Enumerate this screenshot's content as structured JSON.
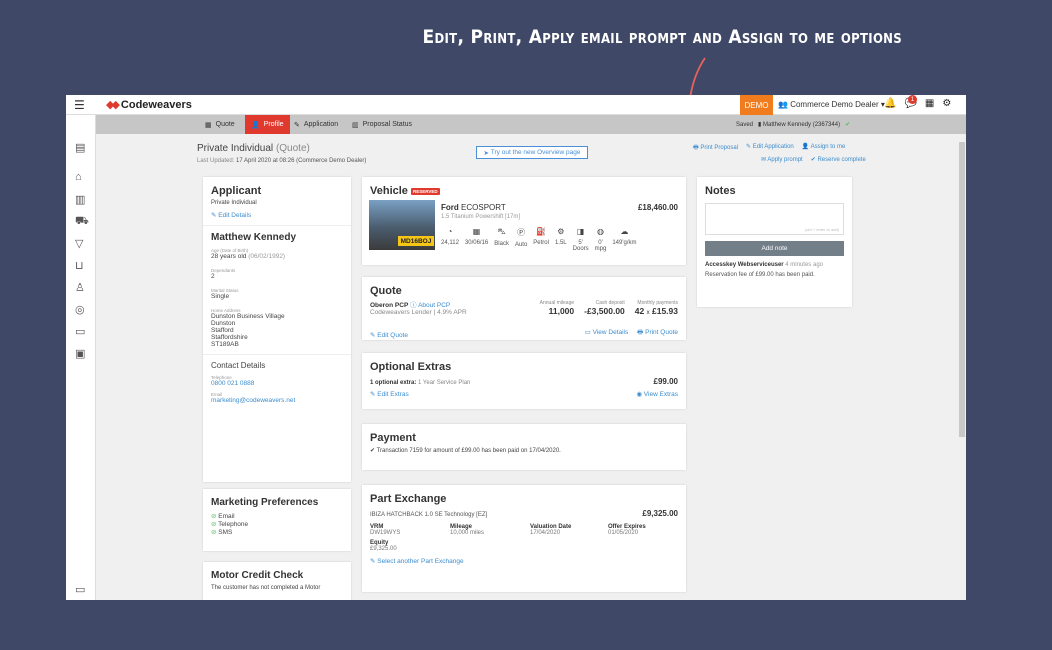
{
  "caption": "Edit, Print, Apply email prompt and Assign to me options",
  "topbar": {
    "brand": "Codeweavers",
    "demo": "DEMO",
    "dealer": "Commerce Demo Dealer",
    "notification_count": "1"
  },
  "nav": {
    "tabs": [
      {
        "label": "Quote",
        "icon": "calculator-icon"
      },
      {
        "label": "Profile",
        "icon": "user-icon"
      },
      {
        "label": "Application",
        "icon": "pencil-icon"
      },
      {
        "label": "Proposal Status",
        "icon": "columns-icon"
      }
    ],
    "saved": "Saved",
    "customer": "Matthew Kennedy (2367344)"
  },
  "page": {
    "title": "Private Individual",
    "title_suffix": "(Quote)",
    "updated_label": "Last Updated:",
    "updated_value": "17 April 2020 at 08:26 (Commerce Demo Dealer)",
    "overview_button": "Try out the new Overview page",
    "actions": {
      "print_proposal": "Print Proposal",
      "edit_application": "Edit Application",
      "assign_to_me": "Assign to me",
      "apply_prompt": "Apply prompt",
      "reserve_complete": "Reserve complete"
    }
  },
  "applicant": {
    "heading": "Applicant",
    "type": "Private Individual",
    "edit": "Edit Details",
    "name": "Matthew Kennedy",
    "age_label": "Age (Date of Birth)",
    "age_value": "28 years old",
    "age_dob": "(06/02/1992)",
    "dependants_label": "Dependants",
    "dependants_value": "2",
    "marital_label": "Marital Status",
    "marital_value": "Single",
    "address_label": "Home Address",
    "address_lines": [
      "Dunston Business Village",
      "Dunston",
      "Stafford",
      "Staffordshire",
      "ST189AB"
    ],
    "contact_heading": "Contact Details",
    "telephone_label": "Telephone",
    "telephone_value": "0800 021 0888",
    "email_label": "Email",
    "email_value": "marketing@codeweavers.net"
  },
  "marketing": {
    "heading": "Marketing Preferences",
    "items": [
      "Email",
      "Telephone",
      "SMS"
    ]
  },
  "motor_credit": {
    "heading": "Motor Credit Check",
    "text": "The customer has not completed a Motor"
  },
  "vehicle": {
    "heading": "Vehicle",
    "badge": "RESERVED",
    "make": "Ford",
    "model": "ECOSPORT",
    "derivative": "1.5 Titanium Powershift [17m]",
    "price": "£18,460.00",
    "plate": "MD16BOJ",
    "specs": [
      {
        "icon": "speedometer-icon",
        "value": "24,112"
      },
      {
        "icon": "calendar-icon",
        "value": "30/06/16"
      },
      {
        "icon": "car-icon",
        "value": "Black"
      },
      {
        "icon": "gearbox-icon",
        "value": "Auto"
      },
      {
        "icon": "fuel-icon",
        "value": "Petrol"
      },
      {
        "icon": "engine-icon",
        "value": "1.5L"
      },
      {
        "icon": "doors-icon",
        "value": "5'",
        "sub": "Doors"
      },
      {
        "icon": "mpg-icon",
        "value": "0'",
        "sub": "mpg"
      },
      {
        "icon": "co2-icon",
        "value": "149'g/km"
      }
    ]
  },
  "quote": {
    "heading": "Quote",
    "product": "Oberon PCP",
    "about": "About PCP",
    "lender": "Codeweavers Lender | 4.9% APR",
    "mileage_label": "Annual mileage",
    "mileage_value": "11,000",
    "deposit_label": "Cash deposit",
    "deposit_value": "-£3,500.00",
    "monthly_label": "Monthly payments",
    "monthly_count": "42",
    "monthly_x": "x",
    "monthly_value": "£15.93",
    "edit": "Edit Quote",
    "view_details": "View Details",
    "print": "Print Quote"
  },
  "optional_extras": {
    "heading": "Optional Extras",
    "count_label": "1 optional extra:",
    "item": "1 Year Service Plan",
    "price": "£99.00",
    "edit": "Edit Extras",
    "view": "View Extras"
  },
  "payment": {
    "heading": "Payment",
    "text": "Transaction 7159 for amount of £99.00 has been paid on 17/04/2020."
  },
  "part_exchange": {
    "heading": "Part Exchange",
    "vehicle": "IBIZA HATCHBACK 1.0 SE Technology [EZ]",
    "price": "£9,325.00",
    "vrm_label": "VRM",
    "vrm_value": "DW19WYS",
    "mileage_label": "Mileage",
    "mileage_value": "10,000 miles",
    "valuation_label": "Valuation Date",
    "valuation_value": "17/04/2020",
    "offer_label": "Offer Expires",
    "offer_value": "01/05/2020",
    "equity_label": "Equity",
    "equity_value": "£9,325.00",
    "select": "Select another Part Exchange"
  },
  "notes": {
    "heading": "Notes",
    "hint": "(ctrl + enter to add)",
    "add_button": "Add note",
    "author": "Accesskey Webserviceuser",
    "time": "4 minutes ago",
    "text": "Reservation fee of £99.00 has been paid."
  }
}
